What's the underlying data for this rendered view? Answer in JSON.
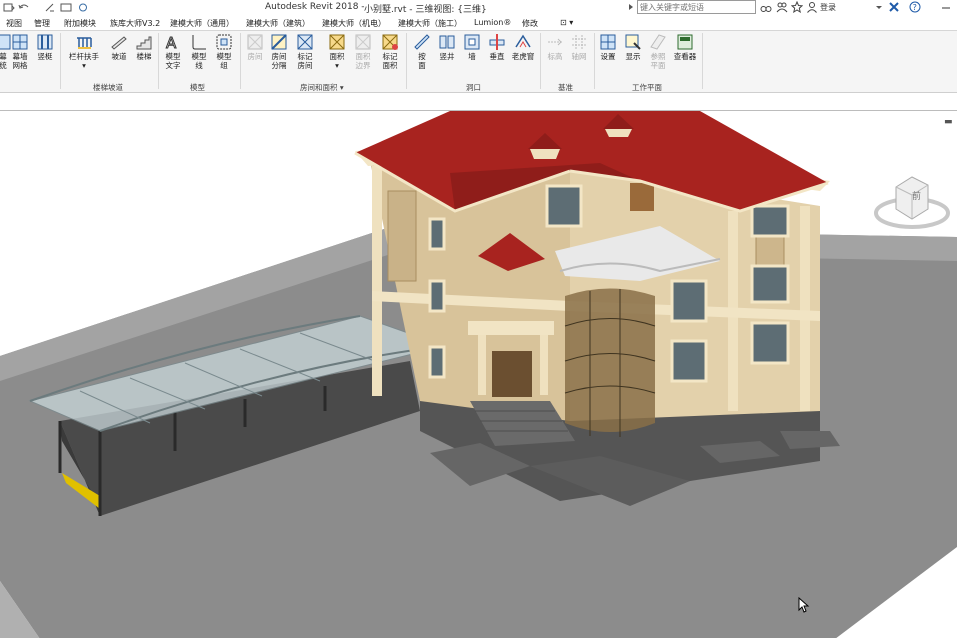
{
  "titlebar": {
    "app_title": "Autodesk Revit 2018 -",
    "doc_title": "小别墅.rvt - 三维视图: {三维}",
    "search_placeholder": "键入关键字或短语",
    "login_label": "登录"
  },
  "tabs": [
    "视图",
    "管理",
    "附加模块",
    "族库大师V3.2",
    "建模大师（通用）",
    "建模大师（建筑）",
    "建模大师（机电）",
    "建模大师（施工）",
    "Lumion®",
    "修改"
  ],
  "ribbon": {
    "left_partial": [
      {
        "label": "幕",
        "sub": "统"
      },
      {
        "label": "幕墙",
        "sub": "网格"
      },
      {
        "label": "竖梃",
        "sub": ""
      }
    ],
    "stairs_group": {
      "label": "楼梯坡道",
      "buttons": [
        {
          "label": "栏杆扶手",
          "sub": ""
        },
        {
          "label": "坡道",
          "sub": ""
        },
        {
          "label": "楼梯",
          "sub": ""
        }
      ]
    },
    "model_group": {
      "label": "模型",
      "buttons": [
        {
          "label": "模型",
          "sub": "文字"
        },
        {
          "label": "模型",
          "sub": "线"
        },
        {
          "label": "模型",
          "sub": "组"
        }
      ]
    },
    "room_group": {
      "label": "房间和面积 ▾",
      "buttons": [
        {
          "label": "房间",
          "sub": "",
          "disabled": true
        },
        {
          "label": "房间",
          "sub": "分隔",
          "disabled": false
        },
        {
          "label": "标记",
          "sub": "房间",
          "disabled": false
        },
        {
          "label": "面积",
          "sub": "",
          "disabled": false
        },
        {
          "label": "面积",
          "sub": "边界",
          "disabled": true
        },
        {
          "label": "标记",
          "sub": "面积",
          "disabled": false
        }
      ]
    },
    "opening_group": {
      "label": "洞口",
      "buttons": [
        {
          "label": "按",
          "sub": "面"
        },
        {
          "label": "竖井",
          "sub": ""
        },
        {
          "label": "墙",
          "sub": ""
        },
        {
          "label": "垂直",
          "sub": ""
        },
        {
          "label": "老虎窗",
          "sub": ""
        }
      ]
    },
    "datum_group": {
      "label": "基准",
      "buttons": [
        {
          "label": "标高",
          "sub": "",
          "disabled": true
        },
        {
          "label": "轴网",
          "sub": "",
          "disabled": true
        }
      ]
    },
    "workplane_group": {
      "label": "工作平面",
      "buttons": [
        {
          "label": "设置",
          "sub": "",
          "disabled": false
        },
        {
          "label": "显示",
          "sub": "",
          "disabled": false
        },
        {
          "label": "参照",
          "sub": "平面",
          "disabled": true
        },
        {
          "label": "查看器",
          "sub": "",
          "disabled": false
        }
      ]
    }
  },
  "viewcube": {
    "face_label": "前"
  },
  "colors": {
    "roof": "#a8231f",
    "wall": "#e2cfa6",
    "trim": "#f4e8cc",
    "base": "#6e6e6e",
    "ground": "#9b9b9b"
  }
}
